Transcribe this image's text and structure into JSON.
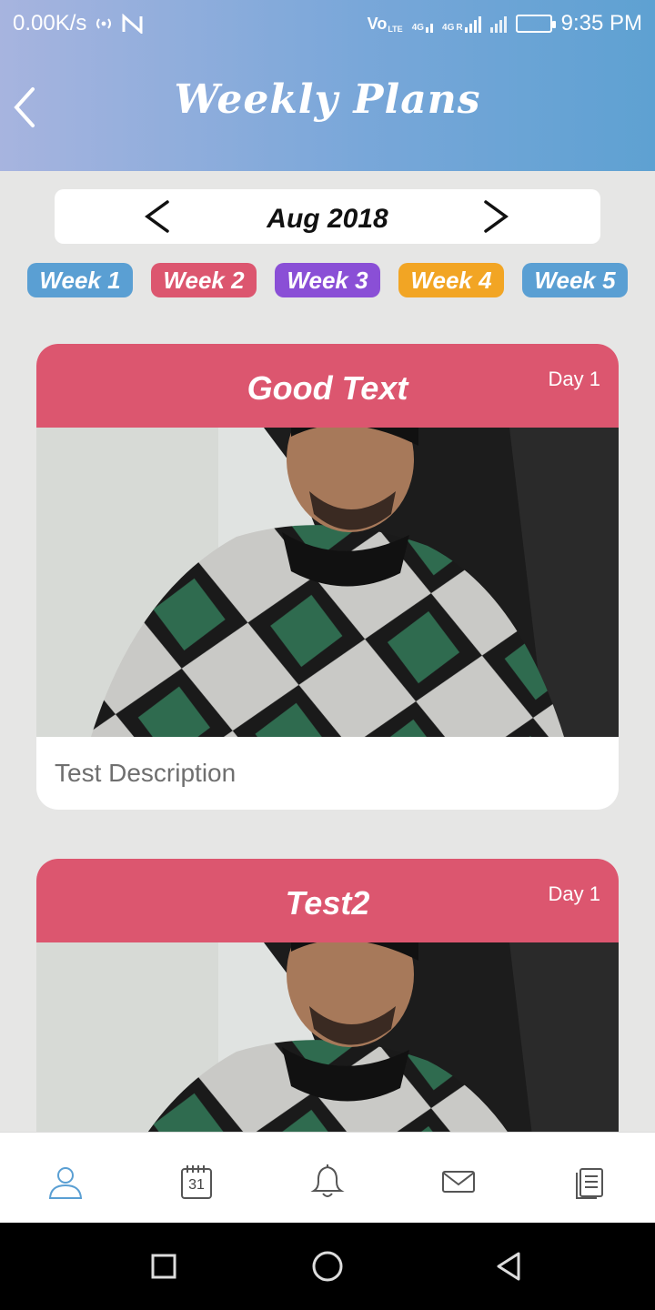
{
  "status_bar": {
    "net_speed": "0.00K/s",
    "volte": "Vo",
    "lte": "LTE",
    "g4a": "4G",
    "g4b": "4G",
    "r": "R",
    "time": "9:35 PM"
  },
  "header": {
    "title": "Weekly Plans"
  },
  "month_picker": {
    "label": "Aug 2018"
  },
  "weeks": [
    {
      "label": "Week 1",
      "color": "#5a9fd3"
    },
    {
      "label": "Week 2",
      "color": "#dc566f"
    },
    {
      "label": "Week 3",
      "color": "#8a4fd6"
    },
    {
      "label": "Week 4",
      "color": "#f2a524"
    },
    {
      "label": "Week 5",
      "color": "#5a9fd3"
    }
  ],
  "plans": [
    {
      "title": "Good Text",
      "day": "Day 1",
      "description": "Test Description"
    },
    {
      "title": "Test2",
      "day": "Day 1"
    }
  ],
  "bottom_nav": {
    "calendar_number": "31",
    "items": [
      "profile-icon",
      "calendar-icon",
      "bell-icon",
      "mail-icon",
      "document-icon"
    ]
  },
  "colors": {
    "header_gradient_start": "#a7b4df",
    "header_gradient_end": "#5ea1d2",
    "card_header": "#dc566f",
    "active_nav": "#5a9fd3",
    "background": "#e6e6e5"
  }
}
